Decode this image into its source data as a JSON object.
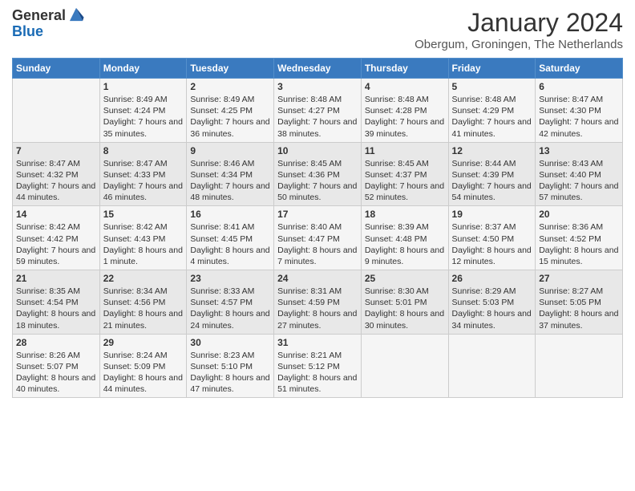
{
  "header": {
    "logo_general": "General",
    "logo_blue": "Blue",
    "month": "January 2024",
    "location": "Obergum, Groningen, The Netherlands"
  },
  "weekdays": [
    "Sunday",
    "Monday",
    "Tuesday",
    "Wednesday",
    "Thursday",
    "Friday",
    "Saturday"
  ],
  "weeks": [
    [
      {
        "day": "",
        "sunrise": "",
        "sunset": "",
        "daylight": ""
      },
      {
        "day": "1",
        "sunrise": "Sunrise: 8:49 AM",
        "sunset": "Sunset: 4:24 PM",
        "daylight": "Daylight: 7 hours and 35 minutes."
      },
      {
        "day": "2",
        "sunrise": "Sunrise: 8:49 AM",
        "sunset": "Sunset: 4:25 PM",
        "daylight": "Daylight: 7 hours and 36 minutes."
      },
      {
        "day": "3",
        "sunrise": "Sunrise: 8:48 AM",
        "sunset": "Sunset: 4:27 PM",
        "daylight": "Daylight: 7 hours and 38 minutes."
      },
      {
        "day": "4",
        "sunrise": "Sunrise: 8:48 AM",
        "sunset": "Sunset: 4:28 PM",
        "daylight": "Daylight: 7 hours and 39 minutes."
      },
      {
        "day": "5",
        "sunrise": "Sunrise: 8:48 AM",
        "sunset": "Sunset: 4:29 PM",
        "daylight": "Daylight: 7 hours and 41 minutes."
      },
      {
        "day": "6",
        "sunrise": "Sunrise: 8:47 AM",
        "sunset": "Sunset: 4:30 PM",
        "daylight": "Daylight: 7 hours and 42 minutes."
      }
    ],
    [
      {
        "day": "7",
        "sunrise": "Sunrise: 8:47 AM",
        "sunset": "Sunset: 4:32 PM",
        "daylight": "Daylight: 7 hours and 44 minutes."
      },
      {
        "day": "8",
        "sunrise": "Sunrise: 8:47 AM",
        "sunset": "Sunset: 4:33 PM",
        "daylight": "Daylight: 7 hours and 46 minutes."
      },
      {
        "day": "9",
        "sunrise": "Sunrise: 8:46 AM",
        "sunset": "Sunset: 4:34 PM",
        "daylight": "Daylight: 7 hours and 48 minutes."
      },
      {
        "day": "10",
        "sunrise": "Sunrise: 8:45 AM",
        "sunset": "Sunset: 4:36 PM",
        "daylight": "Daylight: 7 hours and 50 minutes."
      },
      {
        "day": "11",
        "sunrise": "Sunrise: 8:45 AM",
        "sunset": "Sunset: 4:37 PM",
        "daylight": "Daylight: 7 hours and 52 minutes."
      },
      {
        "day": "12",
        "sunrise": "Sunrise: 8:44 AM",
        "sunset": "Sunset: 4:39 PM",
        "daylight": "Daylight: 7 hours and 54 minutes."
      },
      {
        "day": "13",
        "sunrise": "Sunrise: 8:43 AM",
        "sunset": "Sunset: 4:40 PM",
        "daylight": "Daylight: 7 hours and 57 minutes."
      }
    ],
    [
      {
        "day": "14",
        "sunrise": "Sunrise: 8:42 AM",
        "sunset": "Sunset: 4:42 PM",
        "daylight": "Daylight: 7 hours and 59 minutes."
      },
      {
        "day": "15",
        "sunrise": "Sunrise: 8:42 AM",
        "sunset": "Sunset: 4:43 PM",
        "daylight": "Daylight: 8 hours and 1 minute."
      },
      {
        "day": "16",
        "sunrise": "Sunrise: 8:41 AM",
        "sunset": "Sunset: 4:45 PM",
        "daylight": "Daylight: 8 hours and 4 minutes."
      },
      {
        "day": "17",
        "sunrise": "Sunrise: 8:40 AM",
        "sunset": "Sunset: 4:47 PM",
        "daylight": "Daylight: 8 hours and 7 minutes."
      },
      {
        "day": "18",
        "sunrise": "Sunrise: 8:39 AM",
        "sunset": "Sunset: 4:48 PM",
        "daylight": "Daylight: 8 hours and 9 minutes."
      },
      {
        "day": "19",
        "sunrise": "Sunrise: 8:37 AM",
        "sunset": "Sunset: 4:50 PM",
        "daylight": "Daylight: 8 hours and 12 minutes."
      },
      {
        "day": "20",
        "sunrise": "Sunrise: 8:36 AM",
        "sunset": "Sunset: 4:52 PM",
        "daylight": "Daylight: 8 hours and 15 minutes."
      }
    ],
    [
      {
        "day": "21",
        "sunrise": "Sunrise: 8:35 AM",
        "sunset": "Sunset: 4:54 PM",
        "daylight": "Daylight: 8 hours and 18 minutes."
      },
      {
        "day": "22",
        "sunrise": "Sunrise: 8:34 AM",
        "sunset": "Sunset: 4:56 PM",
        "daylight": "Daylight: 8 hours and 21 minutes."
      },
      {
        "day": "23",
        "sunrise": "Sunrise: 8:33 AM",
        "sunset": "Sunset: 4:57 PM",
        "daylight": "Daylight: 8 hours and 24 minutes."
      },
      {
        "day": "24",
        "sunrise": "Sunrise: 8:31 AM",
        "sunset": "Sunset: 4:59 PM",
        "daylight": "Daylight: 8 hours and 27 minutes."
      },
      {
        "day": "25",
        "sunrise": "Sunrise: 8:30 AM",
        "sunset": "Sunset: 5:01 PM",
        "daylight": "Daylight: 8 hours and 30 minutes."
      },
      {
        "day": "26",
        "sunrise": "Sunrise: 8:29 AM",
        "sunset": "Sunset: 5:03 PM",
        "daylight": "Daylight: 8 hours and 34 minutes."
      },
      {
        "day": "27",
        "sunrise": "Sunrise: 8:27 AM",
        "sunset": "Sunset: 5:05 PM",
        "daylight": "Daylight: 8 hours and 37 minutes."
      }
    ],
    [
      {
        "day": "28",
        "sunrise": "Sunrise: 8:26 AM",
        "sunset": "Sunset: 5:07 PM",
        "daylight": "Daylight: 8 hours and 40 minutes."
      },
      {
        "day": "29",
        "sunrise": "Sunrise: 8:24 AM",
        "sunset": "Sunset: 5:09 PM",
        "daylight": "Daylight: 8 hours and 44 minutes."
      },
      {
        "day": "30",
        "sunrise": "Sunrise: 8:23 AM",
        "sunset": "Sunset: 5:10 PM",
        "daylight": "Daylight: 8 hours and 47 minutes."
      },
      {
        "day": "31",
        "sunrise": "Sunrise: 8:21 AM",
        "sunset": "Sunset: 5:12 PM",
        "daylight": "Daylight: 8 hours and 51 minutes."
      },
      {
        "day": "",
        "sunrise": "",
        "sunset": "",
        "daylight": ""
      },
      {
        "day": "",
        "sunrise": "",
        "sunset": "",
        "daylight": ""
      },
      {
        "day": "",
        "sunrise": "",
        "sunset": "",
        "daylight": ""
      }
    ]
  ]
}
